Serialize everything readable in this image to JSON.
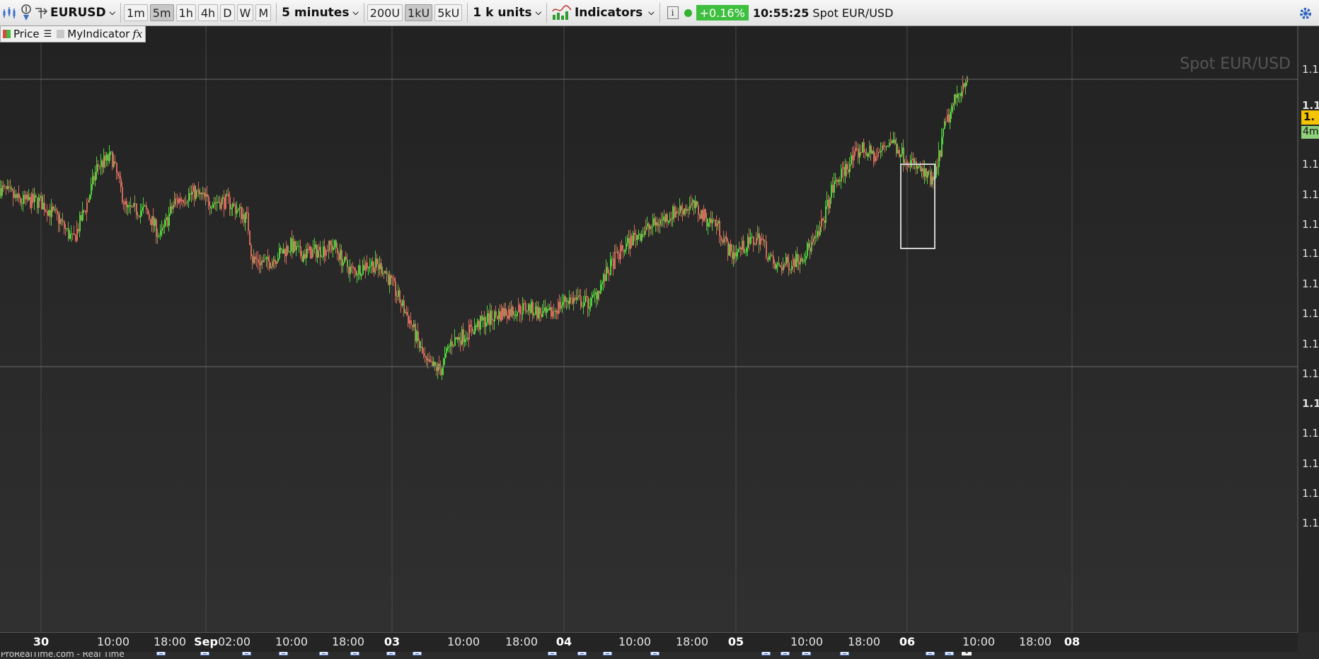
{
  "toolbar": {
    "instrument": "EURUSD",
    "timeframes": [
      "1m",
      "5m",
      "1h",
      "4h",
      "D",
      "W",
      "M"
    ],
    "active_timeframe": "5m",
    "interval": "5 minutes",
    "unit_buttons": [
      "200U",
      "1kU",
      "5kU"
    ],
    "active_unit": "1kU",
    "units": "1 k units",
    "indicators_label": "Indicators",
    "info_glyph": "i",
    "change_pct": "+0.16%",
    "clock": "10:55:25",
    "instrument_name": "Spot EUR/USD",
    "icons": [
      "chart-style-icon",
      "cursor-tool-icon",
      "crosshair-tool-icon",
      "indicator-chart-icon",
      "settings-gear-icon"
    ]
  },
  "legend": {
    "price_label": "Price",
    "indicator_label": "MyIndicator",
    "fx_glyph": "fx"
  },
  "chart": {
    "watermark": "Spot EUR/USD",
    "credit": "ProRealTime.com - Real Time",
    "price_axis_labels": [
      "1.1",
      "1.1",
      "1.1",
      "1.1",
      "1.1",
      "1.1",
      "1.1",
      "1.1",
      "1.1",
      "1.1",
      "1.1",
      "1.1",
      "1.1",
      "1.1",
      "1.1",
      "1.1"
    ],
    "price_tag": "1.",
    "time_tag": "4m",
    "info_marker": "i",
    "time_axis_labels": [
      "30",
      "10:00",
      "18:00",
      "Sep",
      "02:00",
      "10:00",
      "18:00",
      "03",
      "10:00",
      "18:00",
      "04",
      "10:00",
      "18:00",
      "05",
      "10:00",
      "18:00",
      "06",
      "10:00",
      "18:00",
      "08"
    ],
    "major_labels": [
      "30",
      "Sep",
      "03",
      "04",
      "05",
      "06",
      "08"
    ],
    "colors": {
      "background": "#2b2b2b",
      "up": "#4cd13a",
      "down": "#d06a5a",
      "mixed": "#8a9a50",
      "grid": "#4a4a4a",
      "selection_box": "#d0d0d0"
    }
  },
  "chart_data": {
    "type": "candlestick",
    "title": "Spot EUR/USD",
    "x_label": "",
    "y_label": "",
    "x_ticks": [
      "30",
      "10:00",
      "18:00",
      "Sep",
      "02:00",
      "10:00",
      "18:00",
      "03",
      "10:00",
      "18:00",
      "04",
      "10:00",
      "18:00",
      "05",
      "10:00",
      "18:00",
      "06",
      "10:00",
      "18:00",
      "08"
    ],
    "y_ticks": [
      "1.1",
      "1.1",
      "1.1",
      "1.1",
      "1.1",
      "1.1",
      "1.1",
      "1.1",
      "1.1",
      "1.1",
      "1.1",
      "1.1",
      "1.1",
      "1.1",
      "1.1",
      "1.1"
    ],
    "interval": "5 minutes",
    "path_points": [
      [
        0,
        0.73
      ],
      [
        0.02,
        0.7
      ],
      [
        0.04,
        0.7
      ],
      [
        0.06,
        0.66
      ],
      [
        0.075,
        0.61
      ],
      [
        0.09,
        0.7
      ],
      [
        0.1,
        0.78
      ],
      [
        0.115,
        0.8
      ],
      [
        0.13,
        0.68
      ],
      [
        0.15,
        0.68
      ],
      [
        0.165,
        0.62
      ],
      [
        0.18,
        0.7
      ],
      [
        0.2,
        0.72
      ],
      [
        0.215,
        0.7
      ],
      [
        0.235,
        0.7
      ],
      [
        0.255,
        0.66
      ],
      [
        0.26,
        0.57
      ],
      [
        0.275,
        0.56
      ],
      [
        0.3,
        0.6
      ],
      [
        0.31,
        0.58
      ],
      [
        0.33,
        0.59
      ],
      [
        0.345,
        0.6
      ],
      [
        0.355,
        0.56
      ],
      [
        0.365,
        0.54
      ],
      [
        0.38,
        0.56
      ],
      [
        0.395,
        0.55
      ],
      [
        0.405,
        0.51
      ],
      [
        0.425,
        0.42
      ],
      [
        0.44,
        0.33
      ],
      [
        0.455,
        0.32
      ],
      [
        0.465,
        0.38
      ],
      [
        0.48,
        0.4
      ],
      [
        0.5,
        0.43
      ],
      [
        0.52,
        0.45
      ],
      [
        0.545,
        0.46
      ],
      [
        0.565,
        0.44
      ],
      [
        0.585,
        0.48
      ],
      [
        0.61,
        0.47
      ],
      [
        0.635,
        0.57
      ],
      [
        0.655,
        0.62
      ],
      [
        0.67,
        0.64
      ],
      [
        0.685,
        0.66
      ],
      [
        0.7,
        0.68
      ],
      [
        0.715,
        0.69
      ],
      [
        0.73,
        0.66
      ],
      [
        0.74,
        0.65
      ],
      [
        0.755,
        0.58
      ],
      [
        0.77,
        0.6
      ],
      [
        0.785,
        0.62
      ],
      [
        0.8,
        0.55
      ],
      [
        0.815,
        0.56
      ],
      [
        0.83,
        0.58
      ],
      [
        0.845,
        0.62
      ],
      [
        0.86,
        0.73
      ],
      [
        0.875,
        0.78
      ],
      [
        0.89,
        0.82
      ],
      [
        0.905,
        0.8
      ],
      [
        0.92,
        0.84
      ],
      [
        0.935,
        0.8
      ],
      [
        0.95,
        0.77
      ],
      [
        0.965,
        0.74
      ],
      [
        0.975,
        0.86
      ],
      [
        0.985,
        0.92
      ],
      [
        1.0,
        0.99
      ]
    ]
  }
}
